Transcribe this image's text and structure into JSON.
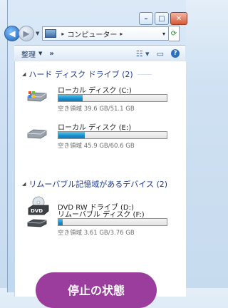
{
  "titlebar": {
    "buttons": [
      "minimize",
      "maximize",
      "close"
    ]
  },
  "nav": {
    "breadcrumb": [
      "コンピューター"
    ],
    "icons": [
      "back-arrow-icon",
      "forward-arrow-icon",
      "computer-icon",
      "refresh-icon"
    ]
  },
  "toolbar": {
    "organize_label": "整理",
    "more_label": "»"
  },
  "groups": {
    "hdd": "ハード ディスク ドライブ (2)",
    "removable": "リムーバブル記憶域があるデバイス (2)"
  },
  "drives": [
    {
      "name": "ローカル ディスク (C:)",
      "free": "空き領域 39.6 GB/51.1 GB",
      "used_fraction": 0.225,
      "icon": "hard-drive-windows-icon"
    },
    {
      "name": "ローカル ディスク (E:)",
      "free": "空き領域 45.9 GB/60.6 GB",
      "used_fraction": 0.243,
      "icon": "hard-drive-icon"
    }
  ],
  "removable": [
    {
      "name": "DVD RW ドライブ (D:)",
      "icon": "dvd-drive-icon",
      "icon_text": "DVD"
    },
    {
      "name": "リムーバブル ディスク (F:)",
      "free": "空き領域 3.61 GB/3.76 GB",
      "used_fraction": 0.04,
      "icon": "removable-disk-icon"
    }
  ],
  "overlay": {
    "text": "停止の状態"
  },
  "colors": {
    "group_text": "#1e3a8a",
    "bar_fill": "#1b8fcf",
    "badge": "#9b3d9c"
  }
}
